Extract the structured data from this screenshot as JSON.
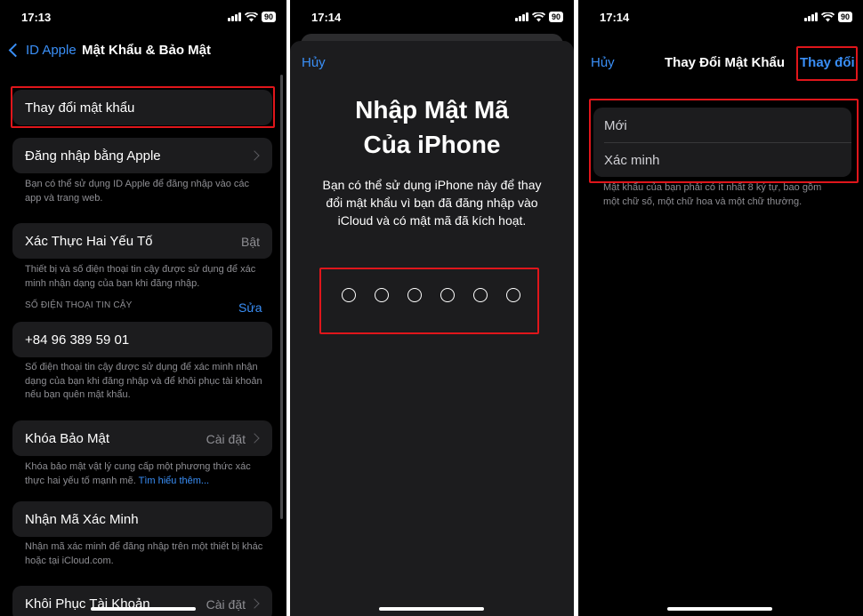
{
  "status_bar": {
    "panel1_time": "17:13",
    "panel2_time": "17:14",
    "panel3_time": "17:14",
    "battery": "90"
  },
  "panel1": {
    "back_label": "ID Apple",
    "title": "Mật Khẩu & Bảo Mật",
    "change_password": "Thay đổi mật khẩu",
    "sign_in_apple": "Đăng nhập bằng Apple",
    "sign_in_apple_note": "Bạn có thể sử dụng ID Apple để đăng nhập vào các app và trang web.",
    "two_factor_label": "Xác Thực Hai Yếu Tố",
    "two_factor_value": "Bật",
    "two_factor_note": "Thiết bị và số điện thoại tin cậy được sử dụng để xác minh nhận dạng của bạn khi đăng nhập.",
    "trusted_header": "SỐ ĐIỆN THOẠI TIN CẬY",
    "edit_label": "Sửa",
    "phone_number": "+84 96 389 59 01",
    "phone_note": "Số điện thoại tin cậy được sử dụng để xác minh nhận dạng của bạn khi đăng nhập và để khôi phục tài khoản nếu bạn quên mật khẩu.",
    "security_key_label": "Khóa Bảo Mật",
    "security_key_value": "Cài đặt",
    "security_key_note": "Khóa bảo mật vật lý cung cấp một phương thức xác thực hai yếu tố mạnh mẽ.",
    "learn_more": "Tìm hiểu thêm...",
    "get_code_label": "Nhận Mã Xác Minh",
    "get_code_note": "Nhận mã xác minh để đăng nhập trên một thiết bị khác hoặc tại iCloud.com.",
    "recovery_label": "Khôi Phục Tài Khoản",
    "recovery_value": "Cài đặt"
  },
  "panel2": {
    "cancel": "Hủy",
    "title_line1": "Nhập Mật Mã",
    "title_line2": "Của iPhone",
    "description": "Bạn có thể sử dụng iPhone này để thay đổi mật khẩu vì bạn đã đăng nhập vào iCloud và có mật mã đã kích hoạt.",
    "passcode_digits_entered": 0,
    "passcode_length": 6
  },
  "panel3": {
    "cancel": "Hủy",
    "title": "Thay Đổi Mật Khẩu",
    "change_button": "Thay đổi",
    "new_placeholder": "Mới",
    "verify_placeholder": "Xác minh",
    "requirement_note": "Mật khẩu của bạn phải có ít nhất 8 ký tự, bao gồm một chữ số, một chữ hoa và một chữ thường."
  },
  "colors": {
    "accent": "#3a8ff7",
    "highlight_box": "#e0161b",
    "background": "#000000",
    "cell": "#1c1c1e"
  }
}
